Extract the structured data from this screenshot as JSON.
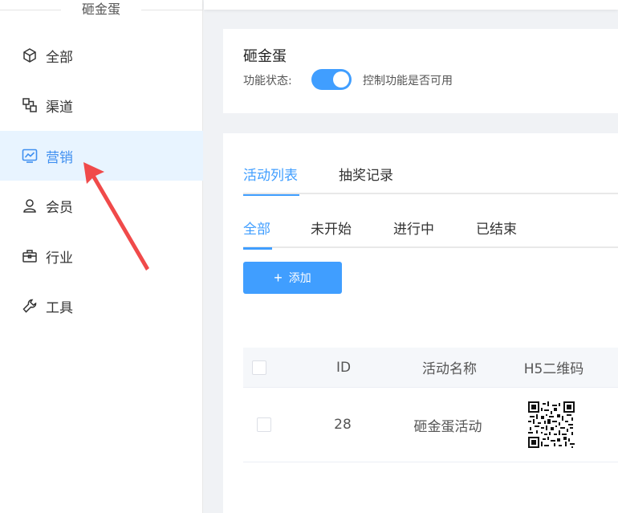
{
  "sidebar": {
    "title": "砸金蛋",
    "items": [
      {
        "label": "全部",
        "icon": "cube-icon"
      },
      {
        "label": "渠道",
        "icon": "channel-icon"
      },
      {
        "label": "营销",
        "icon": "chart-icon",
        "active": true
      },
      {
        "label": "会员",
        "icon": "user-icon"
      },
      {
        "label": "行业",
        "icon": "briefcase-icon"
      },
      {
        "label": "工具",
        "icon": "wrench-icon"
      }
    ]
  },
  "feature": {
    "title": "砸金蛋",
    "status_label": "功能状态:",
    "toggle_on": true,
    "toggle_desc": "控制功能是否可用"
  },
  "tabs_main": [
    {
      "label": "活动列表",
      "active": true
    },
    {
      "label": "抽奖记录",
      "active": false
    }
  ],
  "tabs_sub": [
    {
      "label": "全部",
      "active": true
    },
    {
      "label": "未开始",
      "active": false
    },
    {
      "label": "进行中",
      "active": false
    },
    {
      "label": "已结束",
      "active": false
    }
  ],
  "add_button": {
    "label": "添加"
  },
  "table": {
    "headers": [
      "ID",
      "活动名称",
      "H5二维码"
    ],
    "rows": [
      {
        "id": "28",
        "name": "砸金蛋活动"
      }
    ]
  },
  "colors": {
    "accent": "#409eff",
    "annotation_arrow": "#f04a4a"
  }
}
